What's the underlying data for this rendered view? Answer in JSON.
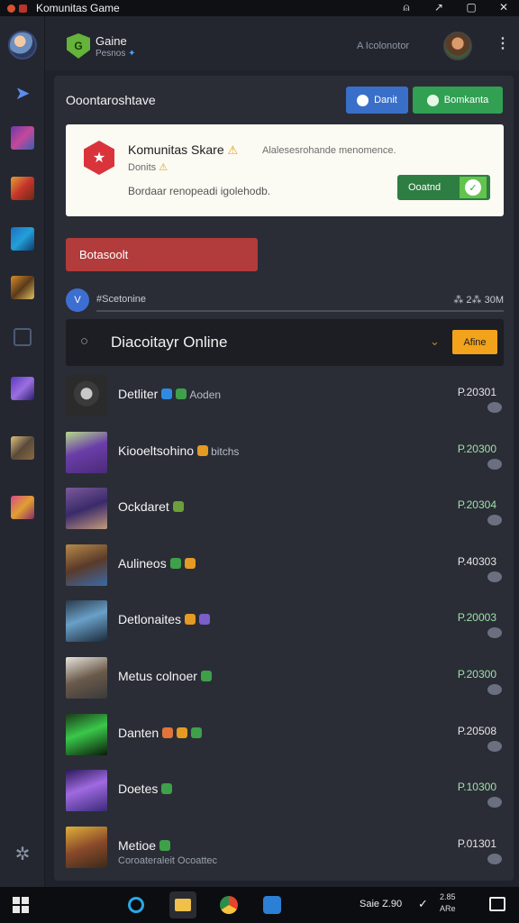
{
  "window": {
    "title": "Komunitas Game",
    "controls": [
      "⍝",
      "↗",
      "▢",
      "✕"
    ]
  },
  "header": {
    "app_name": "Gaine",
    "app_sub": "Pesnos",
    "logo_letter": "G",
    "user": "A Icolonotor",
    "menu": "⋮"
  },
  "main": {
    "section_title": "Ooontaroshtave",
    "btn_blue": "Danit",
    "btn_green": "Bomkanta",
    "share": {
      "title": "Komunitas Skare",
      "desc": "Alalesesrohande menomence.",
      "sub": "Donits",
      "note": "Bordaar renopeadi igolehodb.",
      "button": "Ooatnd"
    },
    "red_button": "Botasoolt",
    "status": {
      "label": "#Scetonine",
      "right": "⁂ 2⁂ 30M",
      "icon": "V"
    },
    "search": {
      "text": "Diacoitayr Online",
      "badge": "Afine"
    }
  },
  "players": [
    {
      "name": "Detliter",
      "sub": "Aoden",
      "badges": [
        "#2f8ae0",
        "#3fa04a"
      ],
      "number": "P.20301",
      "green": false,
      "extra": ""
    },
    {
      "name": "Kiooeltsohino",
      "sub": "bitchs",
      "badges": [
        "#e59a24"
      ],
      "number": "P.20300",
      "green": true,
      "extra": ""
    },
    {
      "name": "Ockdaret",
      "sub": "",
      "badges": [
        "#6c9e3a"
      ],
      "number": "P.20304",
      "green": true,
      "extra": ""
    },
    {
      "name": "Aulineos",
      "sub": "",
      "badges": [
        "#3fa04a",
        "#e59a24"
      ],
      "number": "P.40303",
      "green": false,
      "extra": ""
    },
    {
      "name": "Detlonaites",
      "sub": "",
      "badges": [
        "#e59a24",
        "#7a5fc9"
      ],
      "number": "P.20003",
      "green": true,
      "extra": ""
    },
    {
      "name": "Metus colnoer",
      "sub": "",
      "badges": [
        "#3fa04a"
      ],
      "number": "P.20300",
      "green": true,
      "extra": ""
    },
    {
      "name": "Danten",
      "sub": "",
      "badges": [
        "#e0743a",
        "#e59a24",
        "#3fa04a"
      ],
      "number": "P.20508",
      "green": false,
      "extra": ""
    },
    {
      "name": "Doetes",
      "sub": "",
      "badges": [
        "#3fa04a"
      ],
      "number": "P.10300",
      "green": true,
      "extra": ""
    },
    {
      "name": "Metioe",
      "sub": "",
      "badges": [
        "#3fa04a"
      ],
      "number": "P.01301",
      "green": false,
      "extra": "Coroateraleit Ocoattec"
    }
  ],
  "taskbar": {
    "time": "Saie Z.90",
    "clock_top": "2.85",
    "clock_bottom": "ARe"
  }
}
